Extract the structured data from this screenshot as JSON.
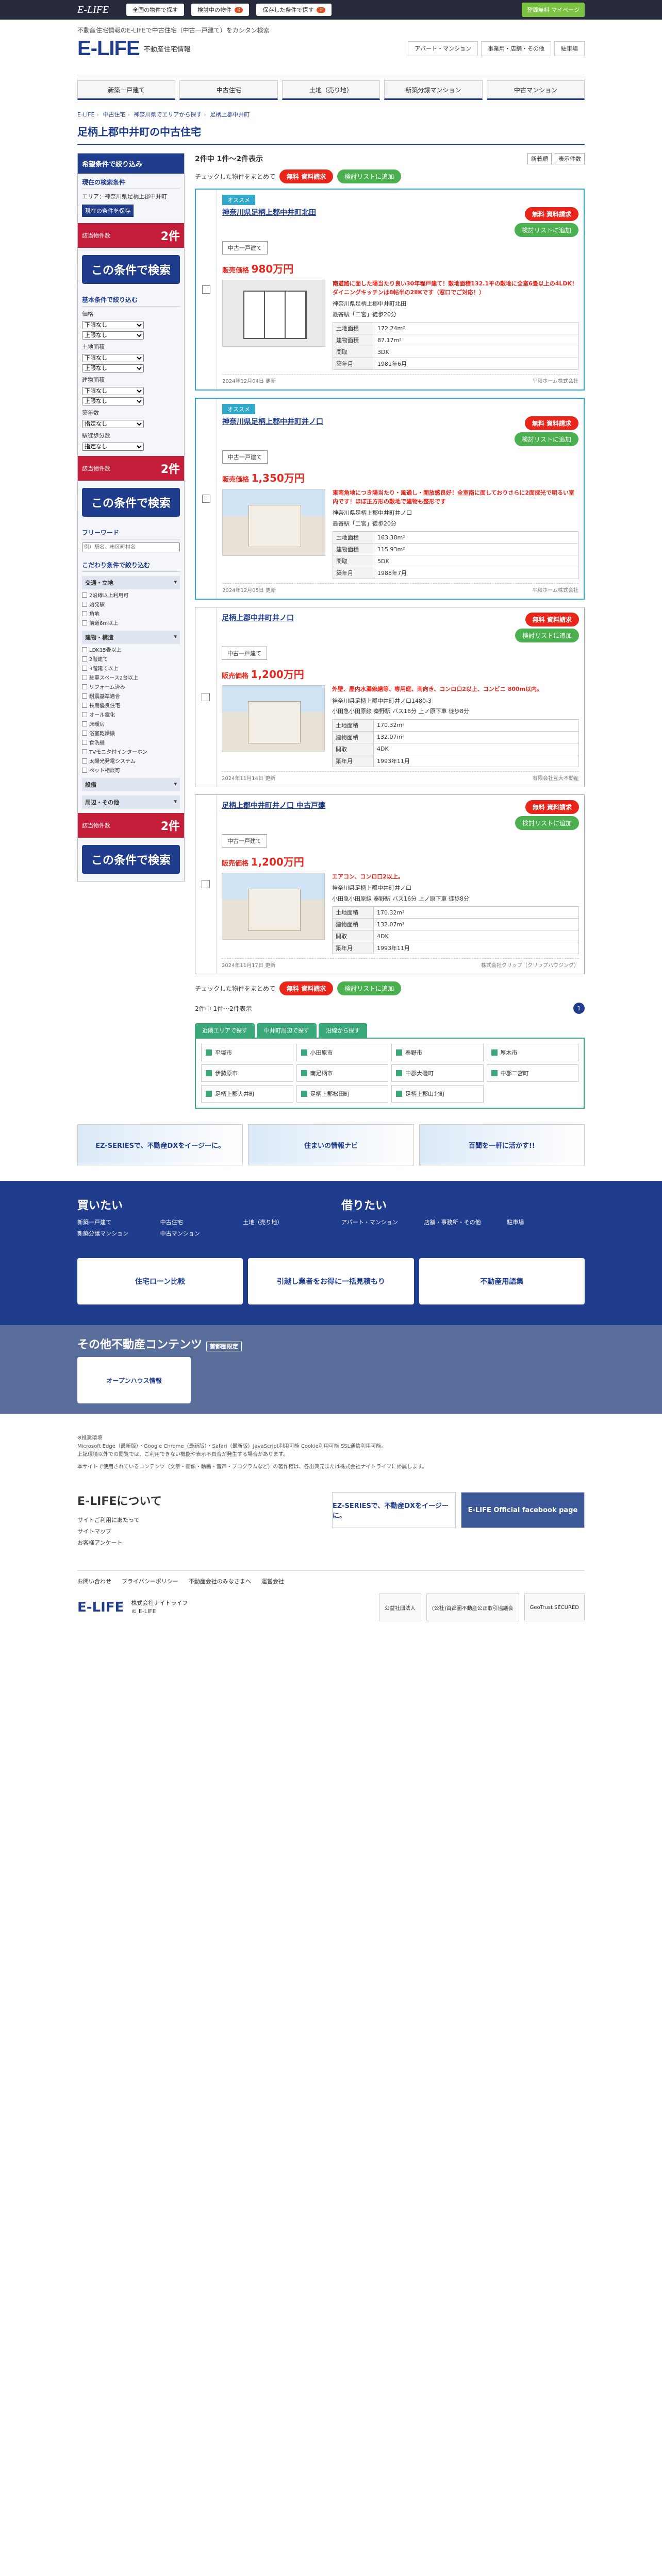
{
  "topbar": {
    "logo": "E-LIFE",
    "btn1": "全国の物件で探す",
    "btn2": "検討中の物件",
    "btn2_count": "0",
    "btn3": "保存した条件で探す",
    "btn3_count": "0",
    "mypage": "登録無料 マイページ"
  },
  "header": {
    "caption": "不動産住宅情報のE-LIFEで中古住宅（中古一戸建て）をカンタン検索",
    "logo": "E-LIFE",
    "name": "不動産住宅情報",
    "links": [
      "アパート・マンション",
      "事業用・店舗・その他",
      "駐車場"
    ]
  },
  "gnav": [
    "新築一戸建て",
    "中古住宅",
    "土地（売り地）",
    "新築分譲マンション",
    "中古マンション"
  ],
  "breadcrumb": [
    "E-LIFE",
    "中古住宅",
    "神奈川県でエリアから探す",
    "足柄上郡中井町"
  ],
  "page_title": "足柄上郡中井町の中古住宅",
  "side": {
    "head": "希望条件で絞り込み",
    "current": "現在の検索条件",
    "area": "エリア：神奈川県足柄上郡中井町",
    "save": "現在の条件を保存",
    "hits_label": "該当物件数",
    "hits": "2件",
    "apply": "この条件で検索",
    "basic": "基本条件で絞り込む",
    "price": "価格",
    "land": "土地面積",
    "bldg": "建物面積",
    "age": "築年数",
    "walk": "駅徒歩分数",
    "lower": "下限なし",
    "upper": "上限なし",
    "none": "指定なし",
    "freeword": "フリーワード",
    "freeword_ph": "例）駅名、市区町村名",
    "kodawari": "こだわり条件で絞り込む",
    "cats": [
      "交通・立地",
      "建物・構造",
      "設備",
      "周辺・その他"
    ],
    "transit": [
      "2沿線以上利用可",
      "始発駅",
      "角地",
      "前道6m以上"
    ],
    "building": [
      "LDK15畳以上",
      "2階建て",
      "3階建て以上",
      "駐車スペース2台以上",
      "リフォーム済み",
      "耐震基準適合",
      "長期優良住宅",
      "オール電化",
      "床暖房",
      "浴室乾燥機",
      "食洗機",
      "TVモニタ付インターホン",
      "太陽光発電システム",
      "ペット相談可"
    ]
  },
  "toolbar": {
    "count": "2件中 1件〜2件表示",
    "sort": "新着順",
    "per": "表示件数"
  },
  "actbar": {
    "label": "チェックした物件をまとめて",
    "req": "無料 資料請求",
    "fav": "検討リストに追加"
  },
  "listings": [
    {
      "rec": "オススメ",
      "title": "神奈川県足柄上郡中井町北田",
      "kind": "中古一戸建て",
      "desc": "南道路に面した陽当たり良い30年程戸建て！敷地面積132.1平の敷地に全室6畳以上の4LDK！ダイニングキッチンは8帖半の2ⅡKです（窓口でご対応！）",
      "addr": "神奈川県足柄上郡中井町北田",
      "station": "最寄駅「二宮」徒歩20分",
      "price_label": "販売価格",
      "price": "980万円",
      "spec": [
        [
          "土地面積",
          "172.24m²"
        ],
        [
          "建物面積",
          "87.17m²"
        ],
        [
          "間取",
          "3DK"
        ],
        [
          "築年月",
          "1981年6月"
        ]
      ],
      "updated": "2024年12月04日 更新",
      "shop": "平和ホーム株式会社",
      "photo": "plan"
    },
    {
      "rec": "オススメ",
      "title": "神奈川県足柄上郡中井町井ノ口",
      "kind": "中古一戸建て",
      "desc": "東南角地につき陽当たり・風通し・開放感良好！全室南に面しておりさらに2面採光で明るい室内です！ほぼ正方形の敷地で建物も整形です",
      "addr": "神奈川県足柄上郡中井町井ノ口",
      "station": "最寄駅「二宮」徒歩20分",
      "price_label": "販売価格",
      "price": "1,350万円",
      "spec": [
        [
          "土地面積",
          "163.38m²"
        ],
        [
          "建物面積",
          "115.93m²"
        ],
        [
          "間取",
          "5DK"
        ],
        [
          "築年月",
          "1988年7月"
        ]
      ],
      "updated": "2024年12月05日 更新",
      "shop": "平和ホーム株式会社",
      "photo": "house"
    },
    {
      "rec": "",
      "title": "足柄上郡中井町井ノ口",
      "kind": "中古一戸建て",
      "desc": "外壁、屋内水漏修繕等、専用庭、南向き、コンロ口2以上、コンビニ 800m以内。",
      "addr": "神奈川県足柄上郡中井町井ノ口1480-3",
      "station": "小田急小田原線 秦野駅 バス16分 上ノ原下車 徒歩8分",
      "price_label": "販売価格",
      "price": "1,200万円",
      "spec": [
        [
          "土地面積",
          "170.32m²"
        ],
        [
          "建物面積",
          "132.07m²"
        ],
        [
          "間取",
          "4DK"
        ],
        [
          "築年月",
          "1993年11月"
        ]
      ],
      "updated": "2024年11月14日 更新",
      "shop": "有限会社互大不動産",
      "photo": "house"
    },
    {
      "rec": "",
      "title": "足柄上郡中井町井ノ口 中古戸建",
      "kind": "中古一戸建て",
      "desc": "エアコン、コンロ口2以上。",
      "addr": "神奈川県足柄上郡中井町井ノ口",
      "station": "小田急小田原線 秦野駅 バス16分 上ノ原下車 徒歩8分",
      "price_label": "販売価格",
      "price": "1,200万円",
      "spec": [
        [
          "土地面積",
          "170.32m²"
        ],
        [
          "建物面積",
          "132.07m²"
        ],
        [
          "間取",
          "4DK"
        ],
        [
          "築年月",
          "1993年11月"
        ]
      ],
      "updated": "2024年11月17日 更新",
      "shop": "株式会社クリップ（クリップハウジング）",
      "photo": "house"
    }
  ],
  "pager": {
    "count": "2件中 1件〜2件表示",
    "page": "1"
  },
  "area_tabs": [
    "近隣エリアで探す",
    "中井町周辺で探す",
    "沿線から探す"
  ],
  "areas": [
    "平塚市",
    "小田原市",
    "秦野市",
    "厚木市",
    "伊勢原市",
    "南足柄市",
    "中郡大磯町",
    "中郡二宮町",
    "足柄上郡大井町",
    "足柄上郡松田町",
    "足柄上郡山北町"
  ],
  "banners": [
    "EZ-SERIESで、不動産DXをイージーに。",
    "住まいの情報ナビ",
    "百聞を一軒に活かす!!"
  ],
  "footer_nav": {
    "buy": "買いたい",
    "buy_links": [
      "新築一戸建て",
      "中古住宅",
      "土地（売り地）",
      "新築分譲マンション",
      "中古マンション"
    ],
    "rent": "借りたい",
    "rent_links": [
      "アパート・マンション",
      "店舗・事務所・その他",
      "駐車場"
    ],
    "promo": [
      "住宅ローン比較",
      "引越し業者をお得に一括見積もり",
      "不動産用語集"
    ]
  },
  "other": {
    "title": "その他不動産コンテンツ",
    "tag": "首都圏限定",
    "banner": "オープンハウス情報"
  },
  "notes": [
    "※推奨環境",
    "Microsoft Edge（最新版）・Google Chrome（最新版）・Safari（最新版）JavaScript利用可能 Cookie利用可能 SSL通信利用可能。",
    "上記環境以外での閲覧では、ご利用できない機能や表示不具合が発生する場合があります。",
    "本サイトで使用されているコンテンツ（文章・画像・動画・音声・プログラムなど）の著作権は、各出典元または株式会社ナイトライフに帰属します。"
  ],
  "about": {
    "title": "E-LIFEについて",
    "links": [
      "サイトご利用にあたって",
      "サイトマップ",
      "お客様アンケート"
    ],
    "b1": "EZ-SERIESで、不動産DXをイージーに。",
    "b2": "E-LIFE Official facebook page"
  },
  "flinks": [
    "お問い合わせ",
    "プライバシーポリシー",
    "不動産会社のみなさまへ",
    "運営会社"
  ],
  "fbot": {
    "logo": "E-LIFE",
    "company": "株式会社ナイトライフ",
    "copy": "© E-LIFE",
    "badge1": "公益社団法人",
    "badge2": "(公社)首都圏不動産公正取引協議会",
    "badge3": "GeoTrust SECURED"
  }
}
